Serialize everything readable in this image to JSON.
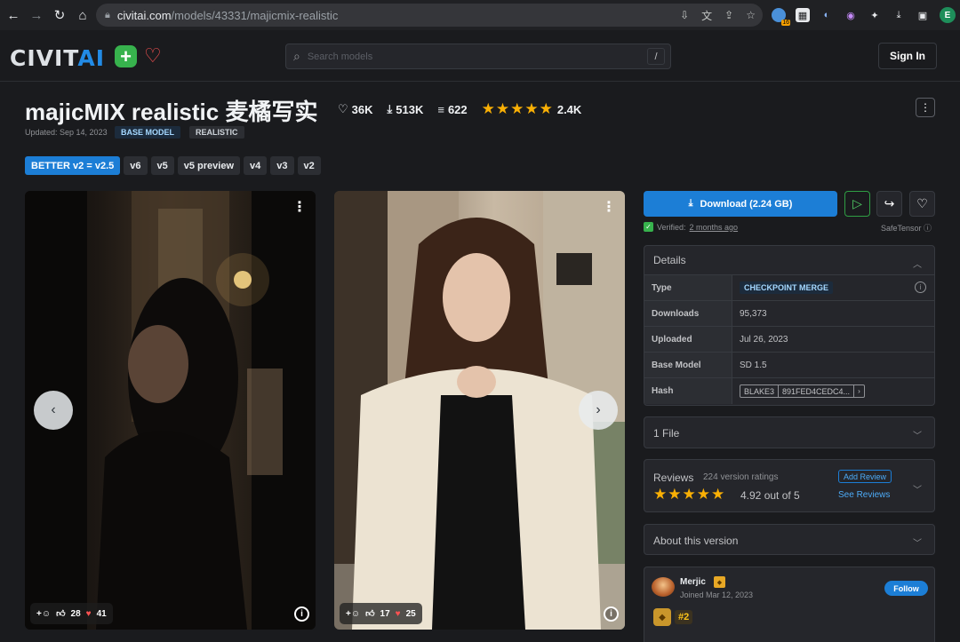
{
  "browser": {
    "url_host": "civitai.com",
    "url_path": "/models/43331/majicmix-realistic",
    "ext_badge": "16",
    "profile_initial": "E"
  },
  "header": {
    "logo_civ": "CIVIT",
    "logo_ai": "AI",
    "search_placeholder": "Search models",
    "search_shortcut": "/",
    "sign_in": "Sign In"
  },
  "model": {
    "title": "majicMIX realistic 麦橘写实",
    "likes": "36K",
    "downloads_short": "513K",
    "comments": "622",
    "rating_count": "2.4K",
    "updated": "Updated: Sep 14, 2023",
    "badges": [
      "BASE MODEL",
      "REALISTIC"
    ]
  },
  "versions": [
    "BETTER v2 = v2.5",
    "v6",
    "v5",
    "v5 preview",
    "v4",
    "v3",
    "v2"
  ],
  "gallery": [
    {
      "reactions": "28",
      "hearts": "41"
    },
    {
      "reactions": "17",
      "hearts": "25"
    }
  ],
  "sidebar": {
    "download_label": "Download (2.24 GB)",
    "verified_prefix": "Verified:",
    "verified_time": "2 months ago",
    "safetensor": "SafeTensor",
    "details_title": "Details",
    "details": {
      "type_label": "Type",
      "type_value": "CHECKPOINT MERGE",
      "downloads_label": "Downloads",
      "downloads_value": "95,373",
      "uploaded_label": "Uploaded",
      "uploaded_value": "Jul 26, 2023",
      "base_model_label": "Base Model",
      "base_model_value": "SD 1.5",
      "hash_label": "Hash",
      "hash_algo": "BLAKE3",
      "hash_value": "891FED4CEDC4..."
    },
    "files_title": "1 File",
    "reviews": {
      "title": "Reviews",
      "count": "224 version ratings",
      "score": "4.92 out of 5",
      "add_review": "Add Review",
      "see_reviews": "See Reviews"
    },
    "about_title": "About this version",
    "creator": {
      "name": "Merjic",
      "joined": "Joined Mar 12, 2023",
      "follow": "Follow",
      "rank": "#2"
    }
  }
}
